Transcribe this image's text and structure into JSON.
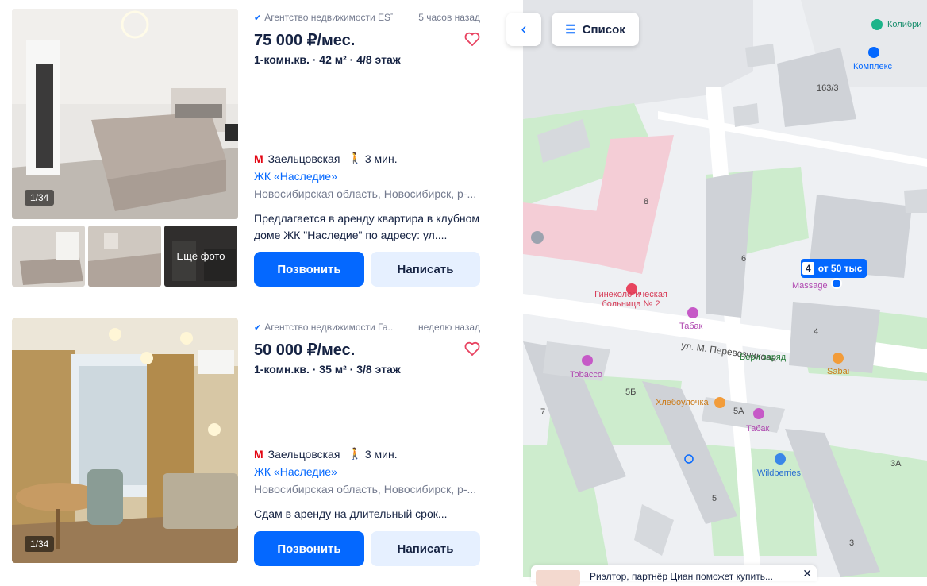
{
  "listings": [
    {
      "agency": "Агентство недвижимости ESTEQ",
      "time": "5 часов назад",
      "price": "75 000 ₽/мес.",
      "params": "1-комн.кв. · 42 м² · 4/8 этаж",
      "metro": "Заельцовская",
      "walk": "3 мин.",
      "complex": "ЖК «Наследие»",
      "address": "Новосибирская область, Новосибирск, р-...",
      "description": "Предлагается в аренду квартира в клубном доме ЖК \"Наследие\" по адресу: ул....",
      "photo_counter": "1/34",
      "more_photos": "Ещё фото",
      "call": "Позвонить",
      "write": "Написать"
    },
    {
      "agency": "Агентство недвижимости Га...",
      "time": "неделю назад",
      "price": "50 000 ₽/мес.",
      "params": "1-комн.кв. · 35 м² · 3/8 этаж",
      "metro": "Заельцовская",
      "walk": "3 мин.",
      "complex": "ЖК «Наследие»",
      "address": "Новосибирская область, Новосибирск, р-...",
      "description": "Сдам в аренду на длительный срок...",
      "photo_counter": "1/34",
      "call": "Позвонить",
      "write": "Написать"
    }
  ],
  "map": {
    "list_button": "Список",
    "price_pin_count": "4",
    "price_pin_label": "от 50 тыс",
    "streets": [
      "ул. М. Перевозчикова"
    ],
    "buildings": [
      "163/3",
      "8",
      "6",
      "4",
      "7",
      "5Б",
      "5А",
      "5",
      "3А",
      "3"
    ],
    "pois": {
      "kolibri": "Колибри",
      "kompleks": "Комплекс",
      "hospital": "Гинекологическая больница № 2",
      "tabak1": "Табак",
      "massage": "Massage",
      "beri": "Бери заряд",
      "sabai": "Sabai",
      "tobacco": "Tobacco",
      "hleb": "Хлебоулочка",
      "tabak2": "Табак",
      "wildberries": "Wildberries"
    },
    "banner_text": "Риэлтор, партнёр Циан поможет купить..."
  }
}
